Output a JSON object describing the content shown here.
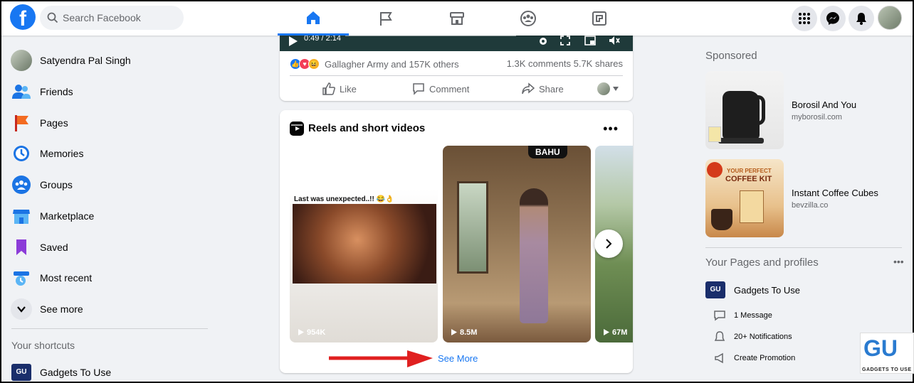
{
  "header": {
    "logo": "f",
    "search_placeholder": "Search Facebook",
    "nav_tabs": [
      "home-icon",
      "pages-flag-icon",
      "marketplace-icon",
      "groups-icon",
      "gaming-icon"
    ],
    "right_icons": [
      "menu-grid-icon",
      "messenger-icon",
      "notifications-icon"
    ]
  },
  "sidebar": {
    "profile_name": "Satyendra Pal Singh",
    "items": [
      {
        "label": "Friends",
        "icon": "friends-icon"
      },
      {
        "label": "Pages",
        "icon": "flag-icon"
      },
      {
        "label": "Memories",
        "icon": "clock-icon"
      },
      {
        "label": "Groups",
        "icon": "groups-icon"
      },
      {
        "label": "Marketplace",
        "icon": "shop-icon"
      },
      {
        "label": "Saved",
        "icon": "bookmark-icon"
      },
      {
        "label": "Most recent",
        "icon": "recent-icon"
      },
      {
        "label": "See more",
        "icon": "chevron-down-icon"
      }
    ],
    "shortcuts_title": "Your shortcuts",
    "shortcut_item": "Gadgets To Use",
    "shortcut_logo": "GU"
  },
  "post": {
    "time": "0:49 / 2:14",
    "progress_fraction": 0.27,
    "reacted_by": "Gallagher Army and 157K others",
    "counts": "1.3K comments  5.7K shares",
    "actions": {
      "like": "Like",
      "comment": "Comment",
      "share": "Share"
    }
  },
  "reels": {
    "title": "Reels and short videos",
    "menu": "•••",
    "caption": "Last was unexpected..!! 😂👌",
    "badge": "BAHU",
    "views": [
      "954K",
      "8.5M",
      "67M"
    ],
    "see_more": "See More"
  },
  "right": {
    "sponsored_title": "Sponsored",
    "ads": [
      {
        "title": "Borosil And You",
        "url": "myborosil.com"
      },
      {
        "title": "Instant Coffee Cubes",
        "url": "bevzilla.co"
      }
    ],
    "coffee_ad_text": [
      "YOUR PERFECT",
      "COFFEE KIT"
    ],
    "pages_title": "Your Pages and profiles",
    "page_name": "Gadgets To Use",
    "page_logo": "GU",
    "page_items": [
      "1 Message",
      "20+ Notifications",
      "Create Promotion"
    ],
    "menu": "•••"
  },
  "watermark": {
    "logo": "GU",
    "text": "GADGETS TO USE"
  },
  "colors": {
    "brand": "#1877f2",
    "arrow": "#e02020"
  }
}
